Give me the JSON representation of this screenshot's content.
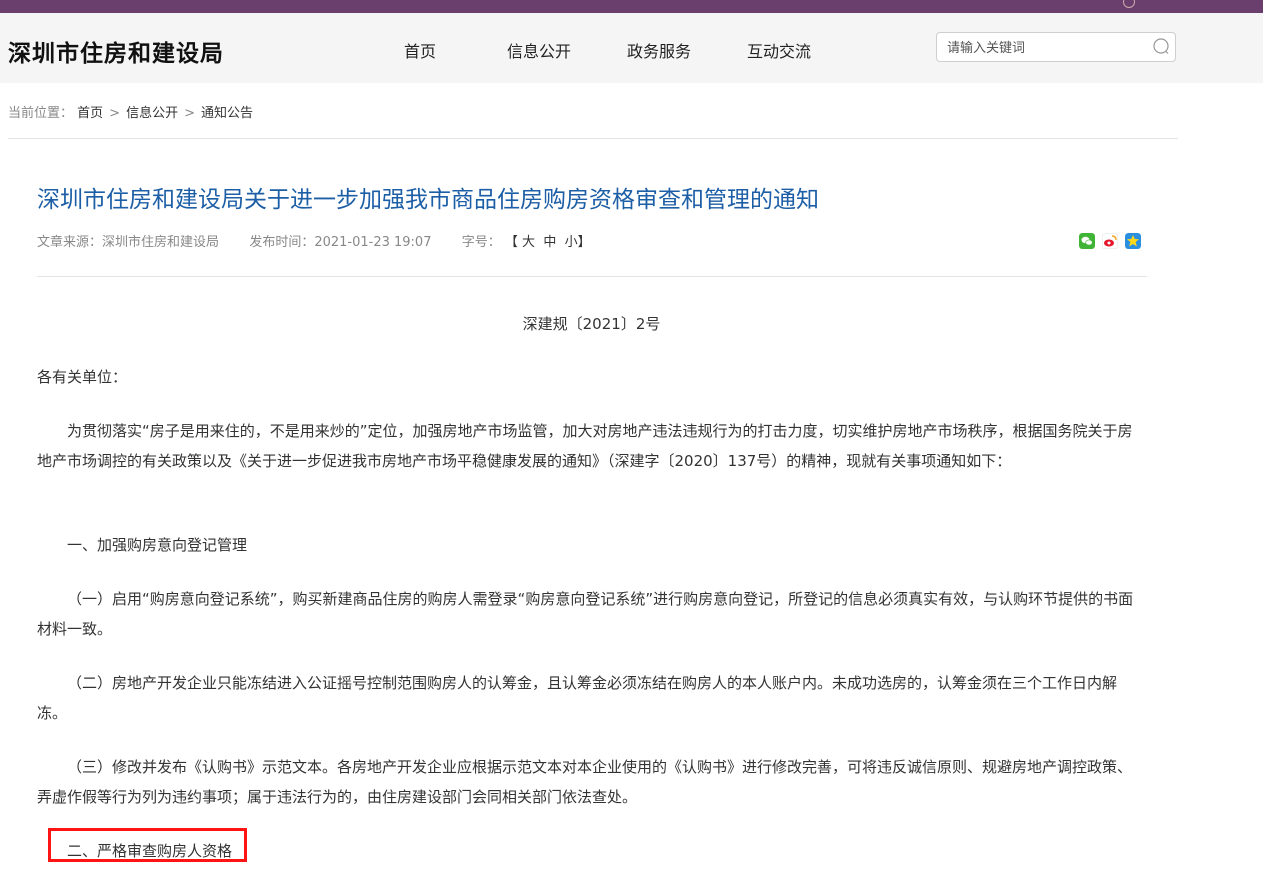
{
  "header": {
    "site_title": "深圳市住房和建设局",
    "nav": [
      "首页",
      "信息公开",
      "政务服务",
      "互动交流"
    ],
    "search_placeholder": "请输入关键词"
  },
  "breadcrumb": {
    "label": "当前位置：",
    "items": [
      "首页",
      "信息公开",
      "通知公告"
    ],
    "separator": ">"
  },
  "article": {
    "title": "深圳市住房和建设局关于进一步加强我市商品住房购房资格审查和管理的通知",
    "source_label": "文章来源：",
    "source": "深圳市住房和建设局",
    "date_label": "发布时间：",
    "date": "2021-01-23 19:07",
    "fontsize_label": "字号：",
    "fontsize_options": "【 大  中  小】",
    "share_icons": [
      "wechat-icon",
      "weibo-icon",
      "qzone-icon"
    ],
    "doc_number": "深建规〔2021〕2号",
    "salutation": "各有关单位：",
    "intro": "为贯彻落实“房子是用来住的，不是用来炒的”定位，加强房地产市场监管，加大对房地产违法违规行为的打击力度，切实维护房地产市场秩序，根据国务院关于房地产市场调控的有关政策以及《关于进一步促进我市房地产市场平稳健康发展的通知》（深建字〔2020〕137号）的精神，现就有关事项通知如下：",
    "section1": "一、加强购房意向登记管理",
    "item1": "（一）启用“购房意向登记系统”，购买新建商品住房的购房人需登录“购房意向登记系统”进行购房意向登记，所登记的信息必须真实有效，与认购环节提供的书面材料一致。",
    "item2": "（二）房地产开发企业只能冻结进入公证摇号控制范围购房人的认筹金，且认筹金必须冻结在购房人的本人账户内。未成功选房的，认筹金须在三个工作日内解冻。",
    "item3": "（三）修改并发布《认购书》示范文本。各房地产开发企业应根据示范文本对本企业使用的《认购书》进行修改完善，可将违反诚信原则、规避房地产调控政策、弄虚作假等行为列为违约事项；属于违法行为的，由住房建设部门会同相关部门依法查处。",
    "section2": "二、严格审查购房人资格"
  },
  "colors": {
    "top_strip": "#6b3f6d",
    "title_blue": "#1d5fa6",
    "highlight_red": "#ff1414"
  }
}
